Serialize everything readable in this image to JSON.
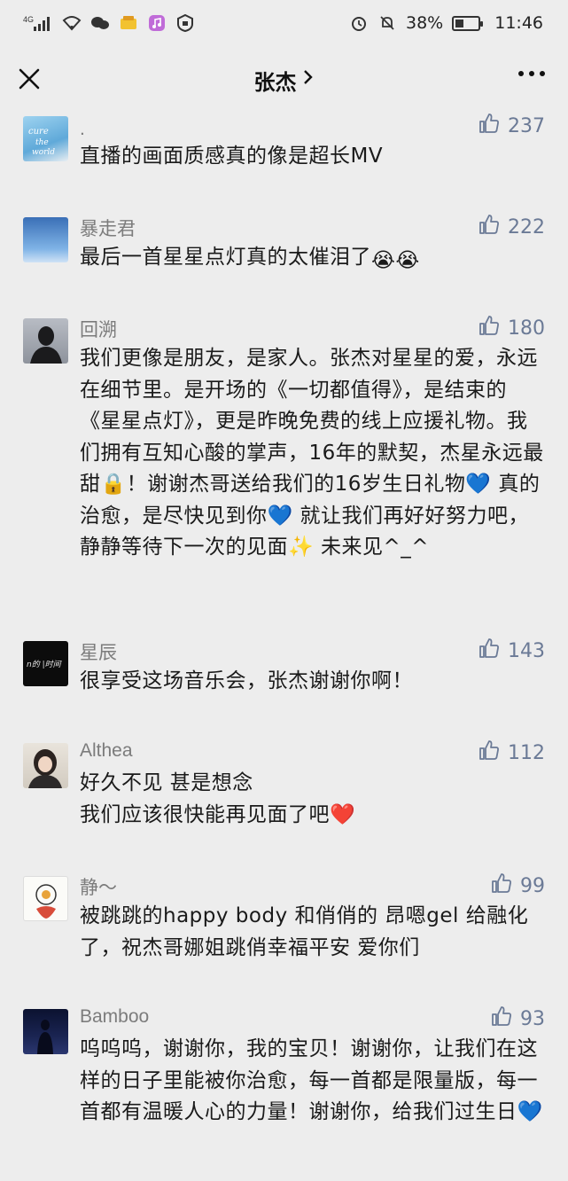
{
  "status_bar": {
    "network": "4G",
    "battery_percent": "38%",
    "battery_level": 0.38,
    "time": "11:46"
  },
  "nav": {
    "title": "张杰",
    "chevron": "›"
  },
  "comments": [
    {
      "name": ".",
      "likes": "237",
      "text": "直播的画面质感真的像是超长MV",
      "emoji_tail": ""
    },
    {
      "name": "暴走君",
      "likes": "222",
      "text": "最后一首星星点灯真的太催泪了",
      "emoji_tail": "😭😭"
    },
    {
      "name": "回溯",
      "likes": "180",
      "text": "我们更像是朋友，是家人。张杰对星星的爱，永远在细节里。是开场的《一切都值得》，是结束的《星星点灯》，更是昨晚免费的线上应援礼物。我们拥有互知心酸的掌声，16年的默契，杰星永远最甜🔒！谢谢杰哥送给我们的16岁生日礼物💙 真的治愈，是尽快见到你💙 就让我们再好好努力吧，静静等待下一次的见面✨ 未来见^_^",
      "emoji_tail": ""
    },
    {
      "name": "星辰",
      "likes": "143",
      "text": "很享受这场音乐会，张杰谢谢你啊！",
      "emoji_tail": ""
    },
    {
      "name": "Althea",
      "likes": "112",
      "text": "好久不见 甚是想念",
      "text2": "我们应该很快能再见面了吧❤️",
      "emoji_tail": ""
    },
    {
      "name": "静～",
      "likes": "99",
      "text": "被跳跳的happy body 和俏俏的 昂嗯gel  给融化了，祝杰哥娜姐跳俏幸福平安 爱你们",
      "emoji_tail": ""
    },
    {
      "name": "Bamboo",
      "likes": "93",
      "text": "呜呜呜，谢谢你，我的宝贝！谢谢你，让我们在这样的日子里能被你治愈，每一首都是限量版，每一首都有温暖人心的力量！谢谢你，给我们过生日💙",
      "emoji_tail": ""
    }
  ],
  "colors": {
    "background": "#ededed",
    "like_color": "#6b7a96",
    "name_color": "#7c7c7c"
  }
}
